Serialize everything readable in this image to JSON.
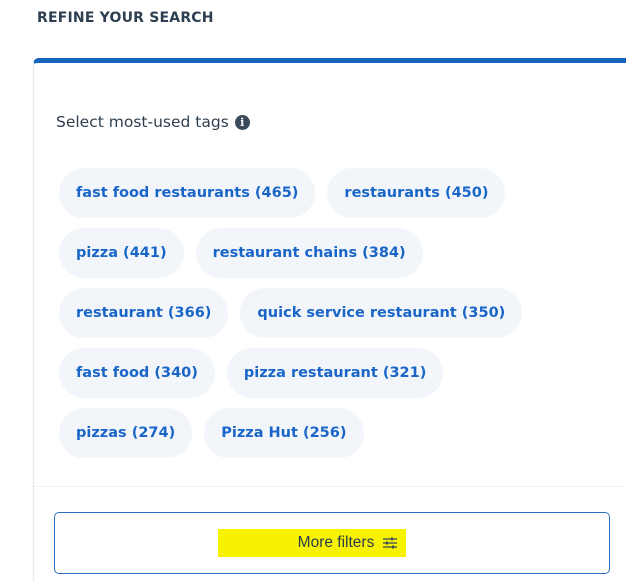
{
  "refine": {
    "heading": "REFINE YOUR SEARCH"
  },
  "panel": {
    "accent_color": "#1565c0",
    "tags_title": "Select most-used tags",
    "info_icon": "info-icon",
    "tags": [
      [
        "fast food restaurants (465)",
        "restaurants (450)"
      ],
      [
        "pizza (441)",
        "restaurant chains (384)"
      ],
      [
        "restaurant (366)",
        "quick service restaurant (350)"
      ],
      [
        "fast food (340)",
        "pizza restaurant (321)"
      ],
      [
        "pizzas (274)",
        "Pizza Hut (256)"
      ]
    ],
    "tag_color": "#1a66c8",
    "tag_background": "#f2f6fb",
    "more_filters": {
      "label": "More filters",
      "icon": "filters-sliders-icon",
      "highlight_color": "#f7f200"
    }
  }
}
